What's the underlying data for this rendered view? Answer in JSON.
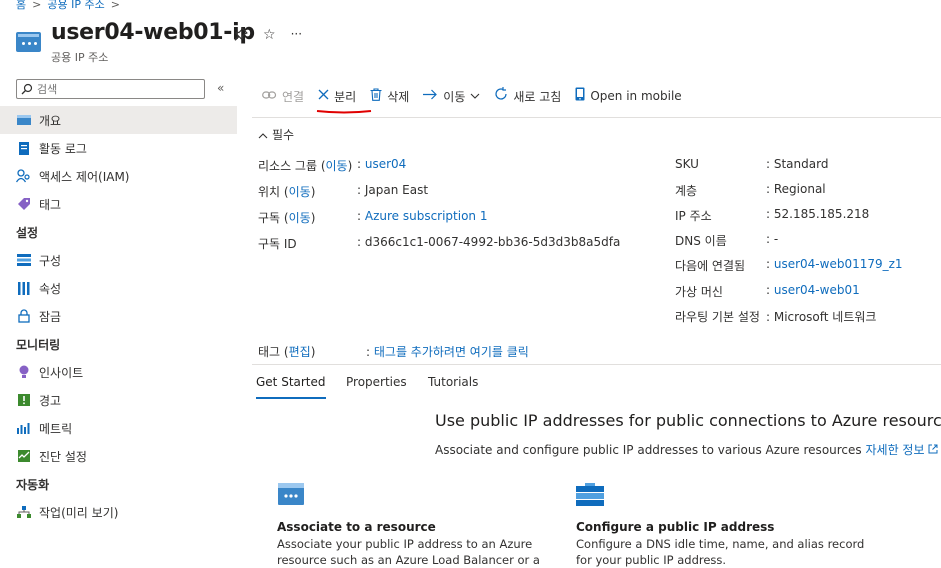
{
  "breadcrumb": {
    "home": "홈",
    "parent": "공용 IP 주소"
  },
  "title": "user04-web01-ip",
  "subtitle": "공용 IP 주소",
  "title_actions": {
    "pin": "✎",
    "favorite": "☆",
    "more": "···"
  },
  "search": {
    "placeholder": "검색",
    "collapse": "«"
  },
  "sidebar": {
    "top_items": [
      {
        "label": "개요",
        "icon": "overview-icon"
      },
      {
        "label": "활동 로그",
        "icon": "activity-log-icon"
      },
      {
        "label": "액세스 제어(IAM)",
        "icon": "iam-icon"
      },
      {
        "label": "태그",
        "icon": "tag-icon"
      }
    ],
    "sections": [
      {
        "title": "설정",
        "items": [
          {
            "label": "구성",
            "icon": "configuration-icon"
          },
          {
            "label": "속성",
            "icon": "properties-icon"
          },
          {
            "label": "잠금",
            "icon": "lock-icon"
          }
        ]
      },
      {
        "title": "모니터링",
        "items": [
          {
            "label": "인사이트",
            "icon": "insights-icon"
          },
          {
            "label": "경고",
            "icon": "alerts-icon"
          },
          {
            "label": "메트릭",
            "icon": "metrics-icon"
          },
          {
            "label": "진단 설정",
            "icon": "diagnostic-settings-icon"
          }
        ]
      },
      {
        "title": "자동화",
        "items": [
          {
            "label": "작업(미리 보기)",
            "icon": "tasks-icon"
          }
        ]
      }
    ]
  },
  "toolbar": {
    "connect": "연결",
    "dissociate": "분리",
    "delete": "삭제",
    "move": "이동",
    "refresh": "새로 고침",
    "open_mobile": "Open in mobile"
  },
  "essentials": {
    "toggle": "필수"
  },
  "props_left": [
    {
      "label": "리소스 그룹",
      "link": "이동",
      "value": "user04",
      "is_link": true
    },
    {
      "label": "위치",
      "link": "이동",
      "value": "Japan East",
      "is_link": false
    },
    {
      "label": "구독",
      "link": "이동",
      "value": "Azure subscription 1",
      "is_link": true
    },
    {
      "label": "구독 ID",
      "link": "",
      "value": "d366c1c1-0067-4992-bb36-5d3d3b8a5dfa",
      "is_link": false
    }
  ],
  "props_right": [
    {
      "label": "SKU",
      "value": "Standard",
      "is_link": false
    },
    {
      "label": "계층",
      "value": "Regional",
      "is_link": false
    },
    {
      "label": "IP 주소",
      "value": "52.185.185.218",
      "is_link": false
    },
    {
      "label": "DNS 이름",
      "value": "-",
      "is_link": false
    },
    {
      "label": "다음에 연결됨",
      "value": "user04-web01179_z1",
      "is_link": true
    },
    {
      "label": "가상 머신",
      "value": "user04-web01",
      "is_link": true
    },
    {
      "label": "라우팅 기본 설정",
      "value": "Microsoft 네트워크",
      "is_link": false
    }
  ],
  "tags": {
    "label": "태그",
    "edit": "편집",
    "value": "태그를 추가하려면 여기를 클릭"
  },
  "tabs": [
    "Get Started",
    "Properties",
    "Tutorials"
  ],
  "promo": {
    "title": "Use public IP addresses for public connections to Azure resources",
    "desc": "Associate and configure public IP addresses to various Azure resources",
    "learn_more": "자세한 정보"
  },
  "cards": [
    {
      "title": "Associate to a resource",
      "lines": [
        "Associate your public IP address to an Azure",
        "resource such as an Azure Load Balancer or a"
      ]
    },
    {
      "title": "Configure a public IP address",
      "lines": [
        "Configure a DNS idle time, name, and alias record",
        "for your public IP address."
      ]
    }
  ],
  "colors": {
    "accent": "#0f6cbd",
    "annotation": "#e00000"
  }
}
